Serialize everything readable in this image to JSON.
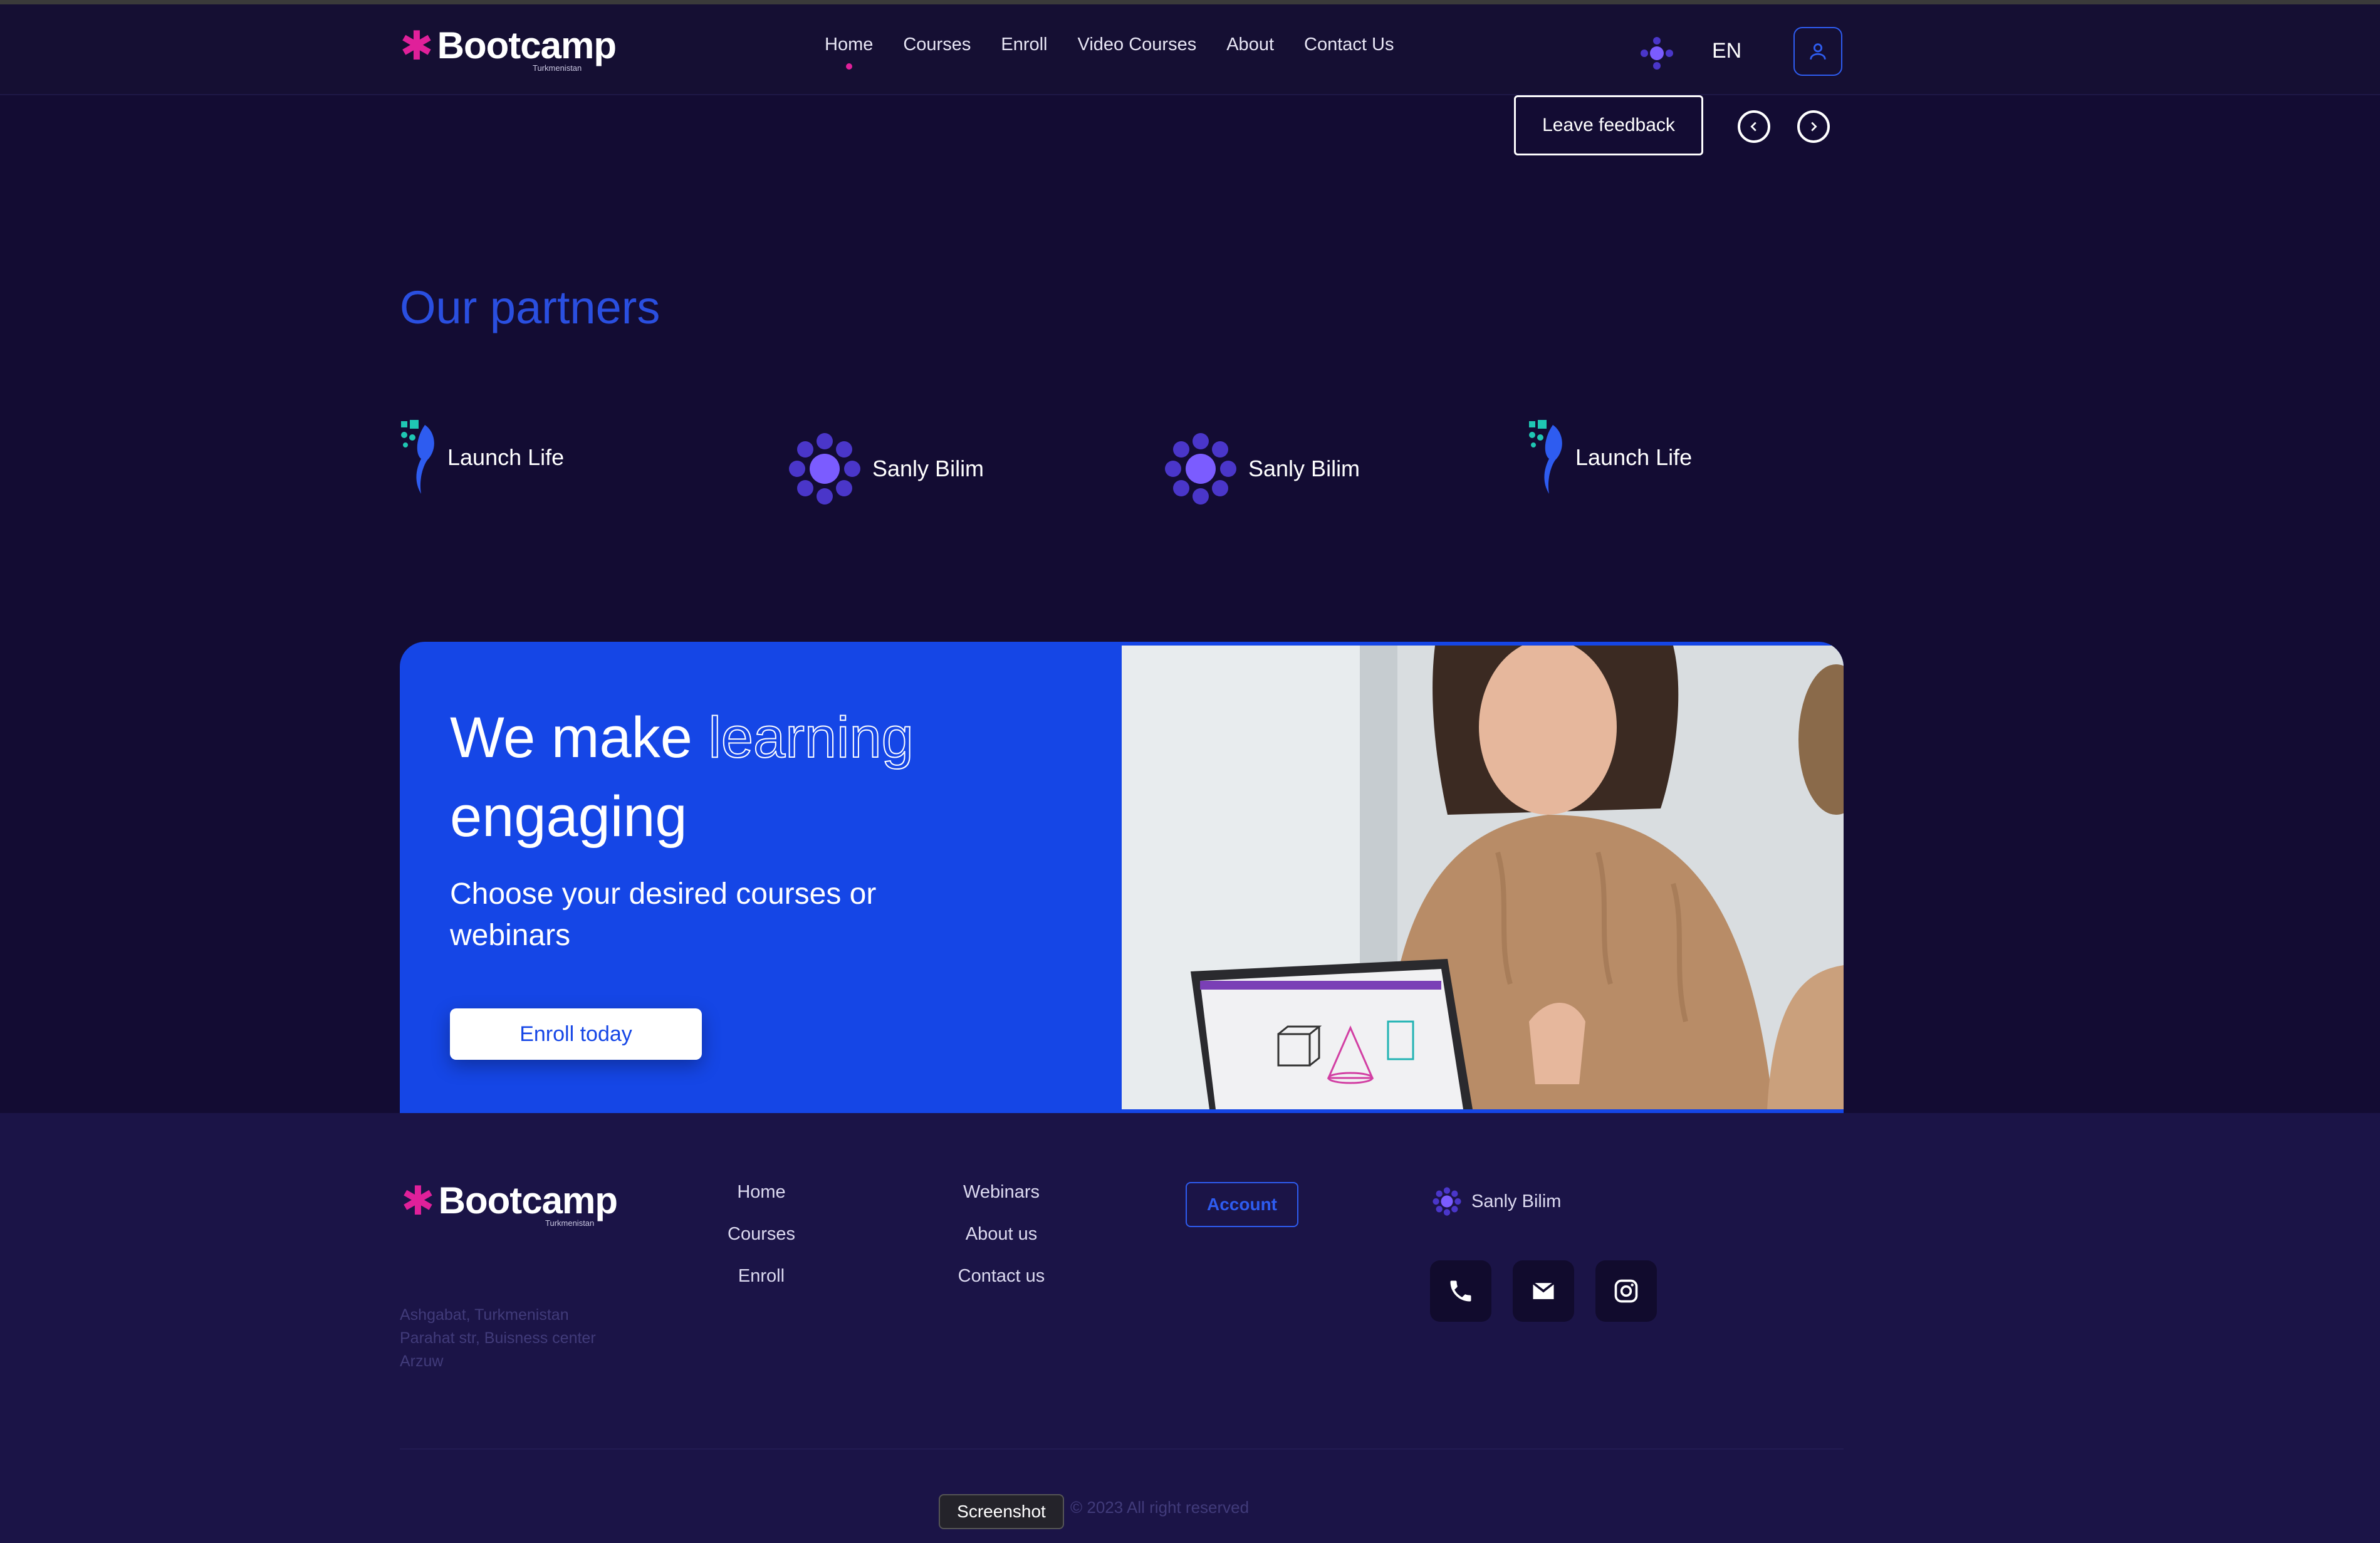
{
  "header": {
    "logo": {
      "name": "Bootcamp",
      "sub": "Turkmenistan"
    },
    "nav": [
      "Home",
      "Courses",
      "Enroll",
      "Video Courses",
      "About",
      "Contact Us"
    ],
    "active_nav": "Home",
    "language": "EN"
  },
  "feedback": {
    "label": "Leave feedback"
  },
  "partners": {
    "title": "Our partners",
    "items": [
      {
        "name": "Launch Life",
        "logo": "launch-life-logo"
      },
      {
        "name": "Sanly Bilim",
        "logo": "sanly-bilim-logo"
      },
      {
        "name": "Sanly Bilim",
        "logo": "sanly-bilim-logo"
      },
      {
        "name": "Launch Life",
        "logo": "launch-life-logo"
      }
    ]
  },
  "hero": {
    "title_part1": "We make",
    "title_outline": "learning",
    "title_part2": "engaging",
    "subtitle": "Choose your desired courses or webinars",
    "cta": "Enroll today"
  },
  "footer": {
    "logo": {
      "name": "Bootcamp",
      "sub": "Turkmenistan"
    },
    "address": [
      "Ashgabat, Turkmenistan",
      "Parahat str, Buisness center",
      "Arzuw"
    ],
    "col1": [
      "Home",
      "Courses",
      "Enroll"
    ],
    "col2": [
      "Webinars",
      "About us",
      "Contact us"
    ],
    "account": "Account",
    "partner": "Sanly Bilim",
    "socials": [
      "phone-icon",
      "mail-icon",
      "instagram-icon"
    ],
    "copyright": "© 2023 All right reserved"
  },
  "tooltip": "Screenshot",
  "colors": {
    "bg": "#130c33",
    "accent": "#1546e6",
    "brand": "#e0209a",
    "footer": "#1b1447"
  }
}
